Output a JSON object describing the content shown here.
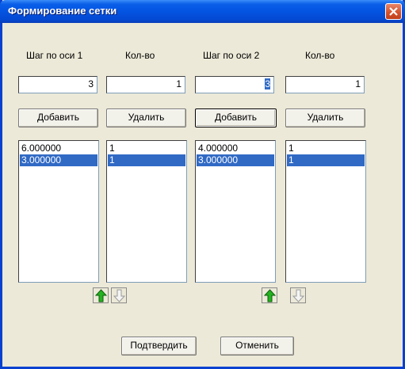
{
  "window": {
    "title": "Формирование сетки"
  },
  "colors": {
    "selection": "#316ac5",
    "arrow_up": "#25b321",
    "arrow_down_disabled": "#b8b8b8",
    "titlebar": "#0454e2",
    "close": "#d4532e"
  },
  "axis1": {
    "step_label": "Шаг по оси 1",
    "count_label": "Кол-во",
    "step_value": "3",
    "count_value": "1",
    "add_label": "Добавить",
    "remove_label": "Удалить",
    "steps": [
      "6.000000",
      "3.000000"
    ],
    "counts": [
      "1",
      "1"
    ],
    "selected_index": 1
  },
  "axis2": {
    "step_label": "Шаг по оси 2",
    "count_label": "Кол-во",
    "step_value": "3",
    "count_value": "1",
    "add_label": "Добавить",
    "remove_label": "Удалить",
    "steps": [
      "4.000000",
      "3.000000"
    ],
    "counts": [
      "1",
      "1"
    ],
    "selected_index": 1
  },
  "icons": {
    "move_up": "green-up-arrow-icon",
    "move_down": "gray-down-arrow-icon",
    "close": "close-icon"
  },
  "footer": {
    "confirm_label": "Подтвердить",
    "cancel_label": "Отменить"
  }
}
